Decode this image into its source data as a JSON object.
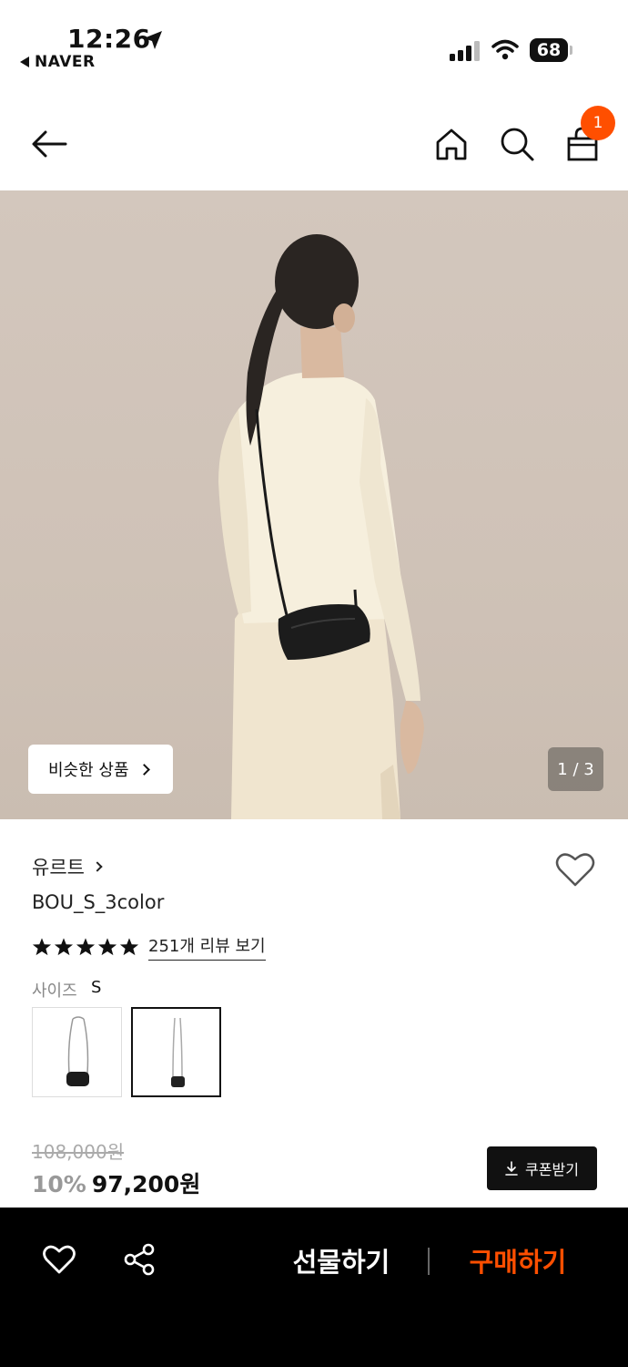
{
  "status_bar": {
    "time": "12:26",
    "back_app": "NAVER",
    "battery": "68",
    "icons": [
      "location-arrow-icon",
      "signal-icon",
      "wifi-icon",
      "battery-icon"
    ]
  },
  "header": {
    "icons": [
      "back-arrow-icon",
      "home-icon",
      "search-icon",
      "shopping-bag-icon"
    ],
    "cart_badge": "1",
    "accent_color": "#ff4f00"
  },
  "hero": {
    "similar_label": "비슷한 상품",
    "pager": "1 / 3"
  },
  "product": {
    "brand": "유르트",
    "name": "BOU_S_3color",
    "rating_stars": 5,
    "review_link": "251개 리뷰 보기",
    "option_label": "사이즈",
    "option_value": "S",
    "original_price": "108,000원",
    "discount": "10%",
    "price": "97,200원",
    "coupon_label": "쿠폰받기"
  },
  "bottom_bar": {
    "gift_label": "선물하기",
    "buy_label": "구매하기",
    "buy_color": "#ff4f00"
  }
}
